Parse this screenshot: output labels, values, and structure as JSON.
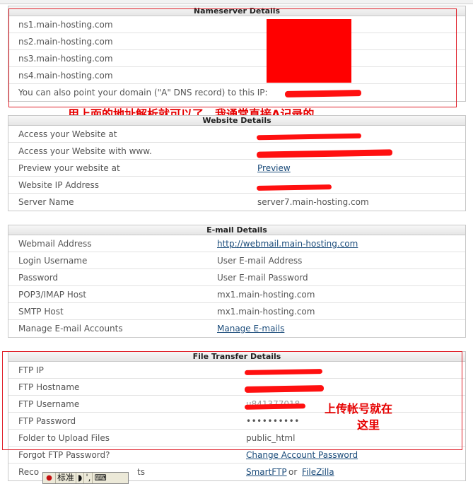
{
  "nameserver": {
    "title": "Nameserver Details",
    "ns": [
      "ns1.main-hosting.com",
      "ns2.main-hosting.com",
      "ns3.main-hosting.com",
      "ns4.main-hosting.com"
    ],
    "ip_hint": "You can also point your domain (\"A\" DNS record) to this IP:"
  },
  "annotation_top": "用上面的地址解析就可以了，我通常直接A记录的",
  "website": {
    "title": "Website Details",
    "rows": [
      {
        "label": "Access your Website at",
        "value": ""
      },
      {
        "label": "Access your Website with www.",
        "value": ""
      },
      {
        "label": "Preview your website at",
        "value": "Preview"
      },
      {
        "label": "Website IP Address",
        "value": ""
      },
      {
        "label": "Server Name",
        "value": "server7.main-hosting.com"
      }
    ]
  },
  "email": {
    "title": "E-mail Details",
    "rows": [
      {
        "label": "Webmail Address",
        "value": "http://webmail.main-hosting.com"
      },
      {
        "label": "Login Username",
        "value": "User E-mail Address"
      },
      {
        "label": "Password",
        "value": "User E-mail Password"
      },
      {
        "label": "POP3/IMAP Host",
        "value": "mx1.main-hosting.com"
      },
      {
        "label": "SMTP Host",
        "value": "mx1.main-hosting.com"
      },
      {
        "label": "Manage E-mail Accounts",
        "value": "Manage E-mails"
      }
    ]
  },
  "ftp": {
    "title": "File Transfer Details",
    "rows": [
      {
        "label": "FTP IP",
        "value": ""
      },
      {
        "label": "FTP Hostname",
        "value": ""
      },
      {
        "label": "FTP Username",
        "value": "u841377018"
      },
      {
        "label": "FTP Password",
        "value": "••••••••••"
      },
      {
        "label": "Folder to Upload Files",
        "value": "public_html"
      },
      {
        "label": "Forgot FTP Password?",
        "value": "Change Account Password"
      },
      {
        "label": "Reco",
        "label_tail": "ts",
        "value": "SmartFTP",
        "or": "or",
        "value2": "FileZilla"
      }
    ]
  },
  "annotation_ftp_line1": "上传帐号就在",
  "annotation_ftp_line2": "这里",
  "ime": {
    "label": "标准"
  },
  "colors": {
    "annotation": "#e60000",
    "link": "#1a4b7a",
    "redact": "#ff1010"
  }
}
